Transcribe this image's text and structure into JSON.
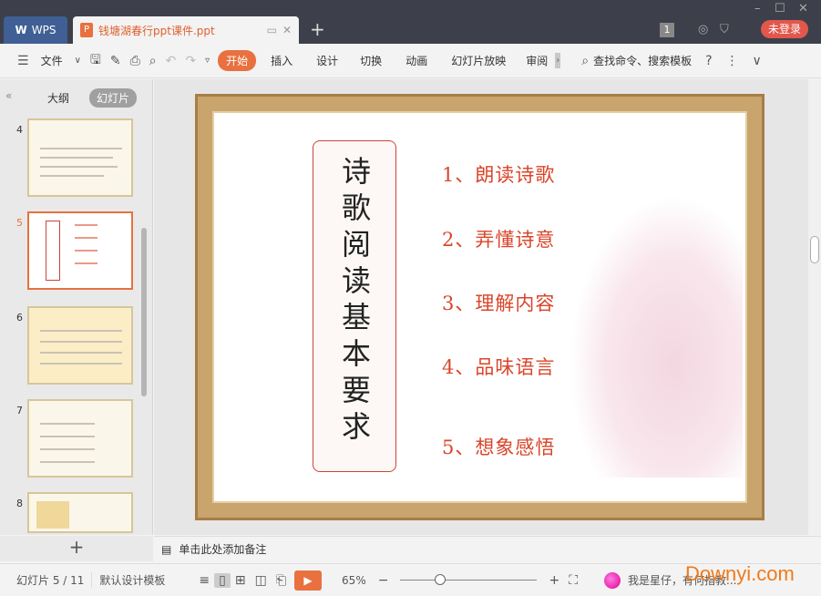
{
  "window": {
    "app_tab": "WPS",
    "doc_tab": "钱塘湖春行ppt课件.ppt",
    "badge": "1",
    "login": "未登录"
  },
  "toolbar": {
    "file": "文件",
    "tabs": [
      "开始",
      "插入",
      "设计",
      "切换",
      "动画",
      "幻灯片放映",
      "审阅"
    ],
    "search": "查找命令、搜索模板"
  },
  "left_panel": {
    "tabs": [
      "大纲",
      "幻灯片"
    ],
    "selected_tab": "幻灯片",
    "thumbnails": [
      "4",
      "5",
      "6",
      "7",
      "8"
    ],
    "selected": "5"
  },
  "slide": {
    "title": "诗歌阅读基本要求",
    "items": [
      "1、朗读诗歌",
      "2、弄懂诗意",
      "3、理解内容",
      "4、品味语言",
      "5、想象感悟"
    ]
  },
  "notes": {
    "placeholder": "单击此处添加备注"
  },
  "status": {
    "slide_counter": "幻灯片 5 / 11",
    "template": "默认设计模板",
    "zoom": "65%",
    "message": "我是星仔，有何指教..."
  },
  "watermark": "Downyi.com",
  "colors": {
    "accent": "#e8713f",
    "title_red": "#d9452a",
    "wps_blue": "#3f5f95"
  }
}
